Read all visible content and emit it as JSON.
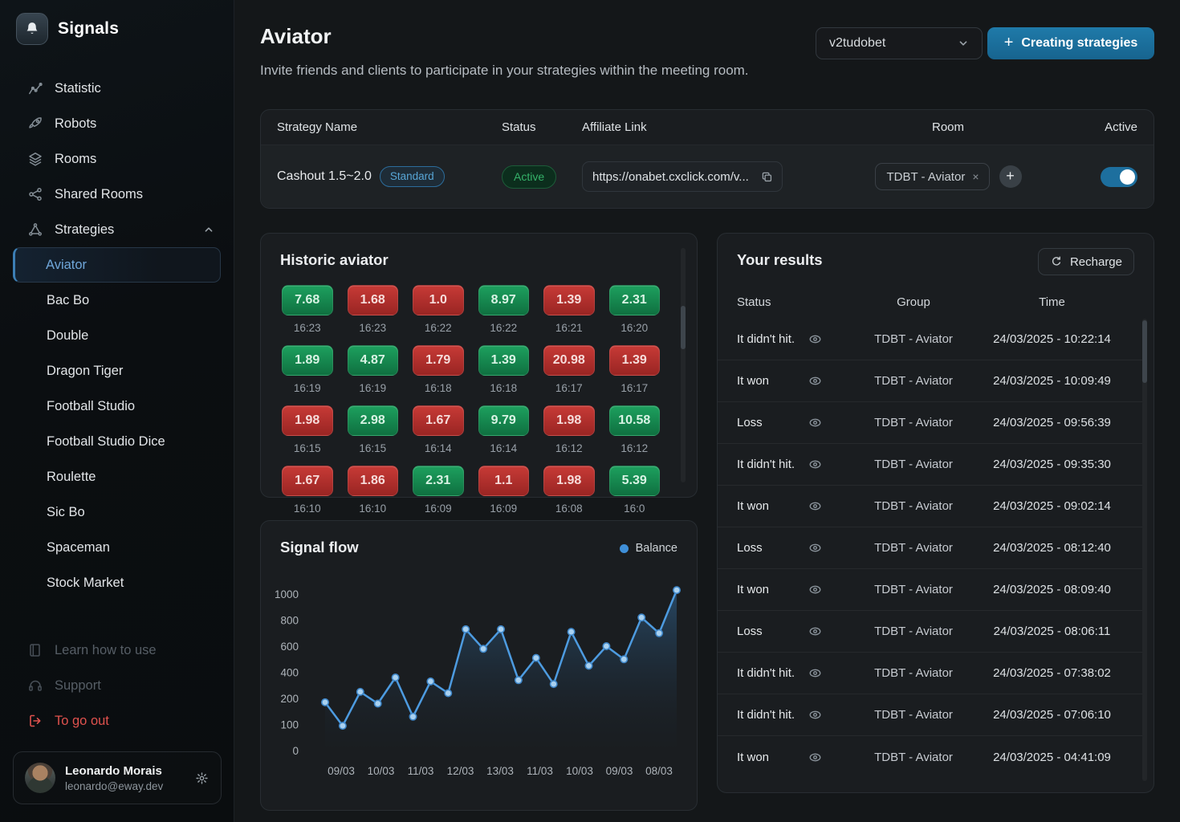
{
  "app": {
    "name": "Signals"
  },
  "sidebar": {
    "items": [
      {
        "label": "Statistic",
        "icon": "stats"
      },
      {
        "label": "Robots",
        "icon": "rocket"
      },
      {
        "label": "Rooms",
        "icon": "layers"
      },
      {
        "label": "Shared Rooms",
        "icon": "share"
      },
      {
        "label": "Strategies",
        "icon": "strategy",
        "expanded": true
      }
    ],
    "strategy_children": [
      {
        "label": "Aviator",
        "active": true
      },
      {
        "label": "Bac Bo"
      },
      {
        "label": "Double"
      },
      {
        "label": "Dragon Tiger"
      },
      {
        "label": "Football Studio"
      },
      {
        "label": "Football Studio Dice"
      },
      {
        "label": "Roulette"
      },
      {
        "label": "Sic Bo"
      },
      {
        "label": "Spaceman"
      },
      {
        "label": "Stock Market"
      }
    ],
    "footer_items": [
      {
        "label": "Learn how to use",
        "icon": "book",
        "style": "muted"
      },
      {
        "label": "Support",
        "icon": "headset",
        "style": "muted"
      },
      {
        "label": "To go out",
        "icon": "logout",
        "style": "danger"
      }
    ],
    "user": {
      "name": "Leonardo Morais",
      "email": "leonardo@eway.dev"
    }
  },
  "header": {
    "title": "Aviator",
    "subtitle": "Invite friends and clients to participate in your strategies within the meeting room.",
    "workspace_select": "v2tudobet",
    "create_button": "Creating strategies",
    "create_plus": "+"
  },
  "strategies_table": {
    "columns": [
      "Strategy Name",
      "Status",
      "Affiliate Link",
      "Room",
      "Active"
    ],
    "row": {
      "name": "Cashout 1.5~2.0",
      "tier_badge": "Standard",
      "status": "Active",
      "affiliate_link": "https://onabet.cxclick.com/v...",
      "room_tag": "TDBT - Aviator",
      "room_tag_close": "×",
      "add_room": "+",
      "active": true
    }
  },
  "historic": {
    "title": "Historic aviator",
    "tiles": [
      {
        "value": "7.68",
        "time": "16:23",
        "win": true
      },
      {
        "value": "1.68",
        "time": "16:23",
        "win": false
      },
      {
        "value": "1.0",
        "time": "16:22",
        "win": false
      },
      {
        "value": "8.97",
        "time": "16:22",
        "win": true
      },
      {
        "value": "1.39",
        "time": "16:21",
        "win": false
      },
      {
        "value": "2.31",
        "time": "16:20",
        "win": true
      },
      {
        "value": "1.89",
        "time": "16:19",
        "win": true
      },
      {
        "value": "4.87",
        "time": "16:19",
        "win": true
      },
      {
        "value": "1.79",
        "time": "16:18",
        "win": false
      },
      {
        "value": "1.39",
        "time": "16:18",
        "win": true
      },
      {
        "value": "20.98",
        "time": "16:17",
        "win": false
      },
      {
        "value": "1.39",
        "time": "16:17",
        "win": false
      },
      {
        "value": "1.98",
        "time": "16:15",
        "win": false
      },
      {
        "value": "2.98",
        "time": "16:15",
        "win": true
      },
      {
        "value": "1.67",
        "time": "16:14",
        "win": false
      },
      {
        "value": "9.79",
        "time": "16:14",
        "win": true
      },
      {
        "value": "1.98",
        "time": "16:12",
        "win": false
      },
      {
        "value": "10.58",
        "time": "16:12",
        "win": true
      },
      {
        "value": "1.67",
        "time": "16:10",
        "win": false
      },
      {
        "value": "1.86",
        "time": "16:10",
        "win": false
      },
      {
        "value": "2.31",
        "time": "16:09",
        "win": true
      },
      {
        "value": "1.1",
        "time": "16:09",
        "win": false
      },
      {
        "value": "1.98",
        "time": "16:08",
        "win": false
      },
      {
        "value": "5.39",
        "time": "16:0",
        "win": true
      }
    ]
  },
  "chart_data": {
    "type": "line",
    "title": "Signal flow",
    "legend": [
      "Balance"
    ],
    "legend_position": "top-right",
    "x_labels": [
      "09/03",
      "10/03",
      "11/03",
      "12/03",
      "13/03",
      "11/03",
      "10/03",
      "09/03",
      "08/03"
    ],
    "y_ticks": [
      0,
      100,
      200,
      400,
      600,
      800,
      1000
    ],
    "grid": false,
    "line_color": "#4d9be0",
    "series": [
      {
        "name": "Balance",
        "values": [
          185,
          95,
          250,
          180,
          360,
          130,
          330,
          240,
          730,
          580,
          730,
          340,
          510,
          310,
          710,
          450,
          600,
          500,
          820,
          700,
          1030
        ]
      }
    ]
  },
  "results": {
    "title": "Your results",
    "recharge_label": "Recharge",
    "columns": [
      "Status",
      "Group",
      "Time"
    ],
    "rows": [
      {
        "status": "It didn't hit.",
        "group": "TDBT - Aviator",
        "time": "24/03/2025 - 10:22:14"
      },
      {
        "status": "It won",
        "group": "TDBT - Aviator",
        "time": "24/03/2025 - 10:09:49"
      },
      {
        "status": "Loss",
        "group": "TDBT - Aviator",
        "time": "24/03/2025 - 09:56:39"
      },
      {
        "status": "It didn't hit.",
        "group": "TDBT - Aviator",
        "time": "24/03/2025 - 09:35:30"
      },
      {
        "status": "It won",
        "group": "TDBT - Aviator",
        "time": "24/03/2025 - 09:02:14"
      },
      {
        "status": "Loss",
        "group": "TDBT - Aviator",
        "time": "24/03/2025 - 08:12:40"
      },
      {
        "status": "It won",
        "group": "TDBT - Aviator",
        "time": "24/03/2025 - 08:09:40"
      },
      {
        "status": "Loss",
        "group": "TDBT - Aviator",
        "time": "24/03/2025 - 08:06:11"
      },
      {
        "status": "It didn't hit.",
        "group": "TDBT - Aviator",
        "time": "24/03/2025 - 07:38:02"
      },
      {
        "status": "It didn't hit.",
        "group": "TDBT - Aviator",
        "time": "24/03/2025 - 07:06:10"
      },
      {
        "status": "It won",
        "group": "TDBT - Aviator",
        "time": "24/03/2025 - 04:41:09"
      }
    ]
  },
  "colors": {
    "accent_blue": "#1d6f9e",
    "active_link_blue": "#6fa6d9",
    "win_green": "#1da05e",
    "loss_red": "#c73a36",
    "status_green": "#35b169",
    "danger_red": "#e0524e",
    "chart_line": "#4d9be0"
  }
}
